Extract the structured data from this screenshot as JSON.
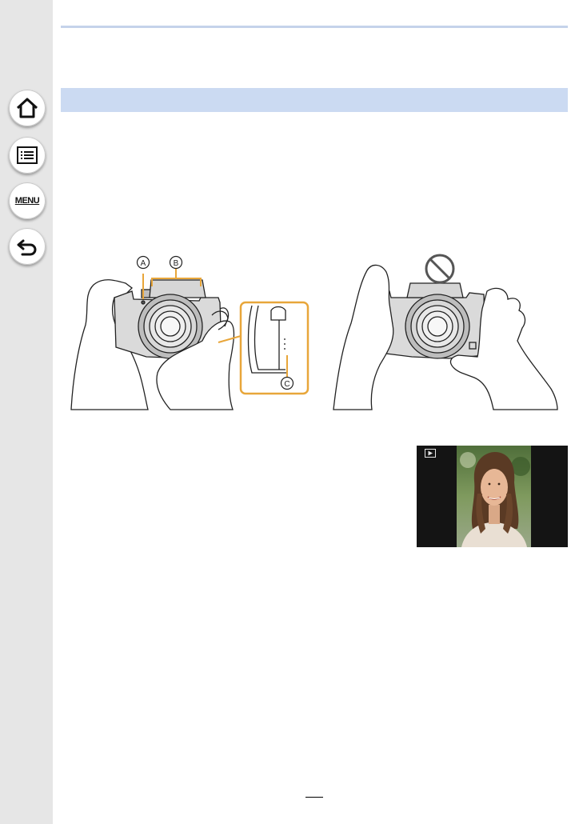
{
  "sidebar": {
    "buttons": [
      {
        "icon": "home-icon"
      },
      {
        "icon": "contents-list-icon"
      },
      {
        "icon": "menu-icon",
        "label": "MENU"
      },
      {
        "icon": "back-icon"
      }
    ]
  },
  "figure": {
    "callouts": {
      "a": "A",
      "b": "B",
      "c": "C"
    },
    "prohibited_icon": "no-symbol-icon"
  },
  "playback_photo": {
    "icon": "play-icon"
  },
  "colors": {
    "sidebar": "#e6e6e6",
    "section_bar": "#cbdaf2",
    "callout_orange": "#e8a63a"
  }
}
